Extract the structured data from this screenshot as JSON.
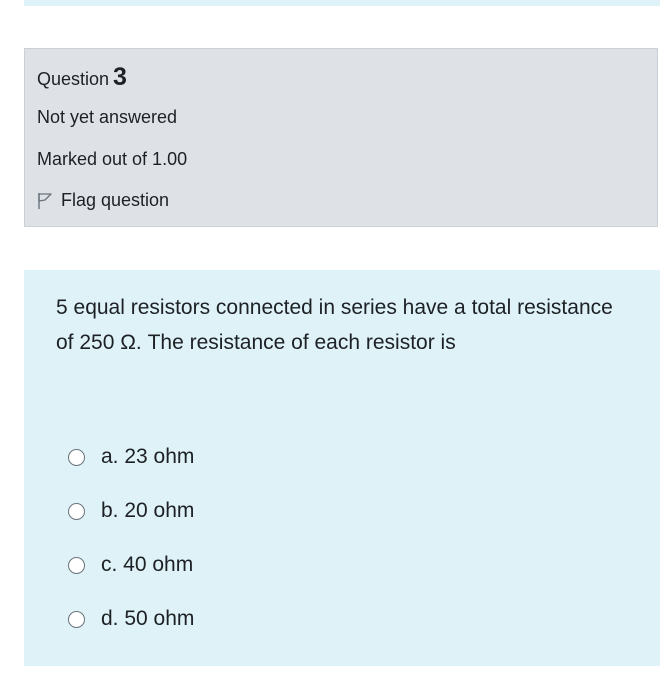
{
  "question": {
    "label": "Question",
    "number": "3",
    "state": "Not yet answered",
    "grade": "Marked out of 1.00",
    "flag_label": "Flag question",
    "text": "5 equal resistors connected in series have a total resistance of 250 Ω. The resistance of each resistor is"
  },
  "answers": [
    {
      "label": "a. 23 ohm"
    },
    {
      "label": "b. 20 ohm"
    },
    {
      "label": "c. 40 ohm"
    },
    {
      "label": "d. 50 ohm"
    }
  ],
  "colors": {
    "info_bg": "#dee2e6",
    "content_bg": "#def2f8",
    "text": "#1d2125"
  }
}
